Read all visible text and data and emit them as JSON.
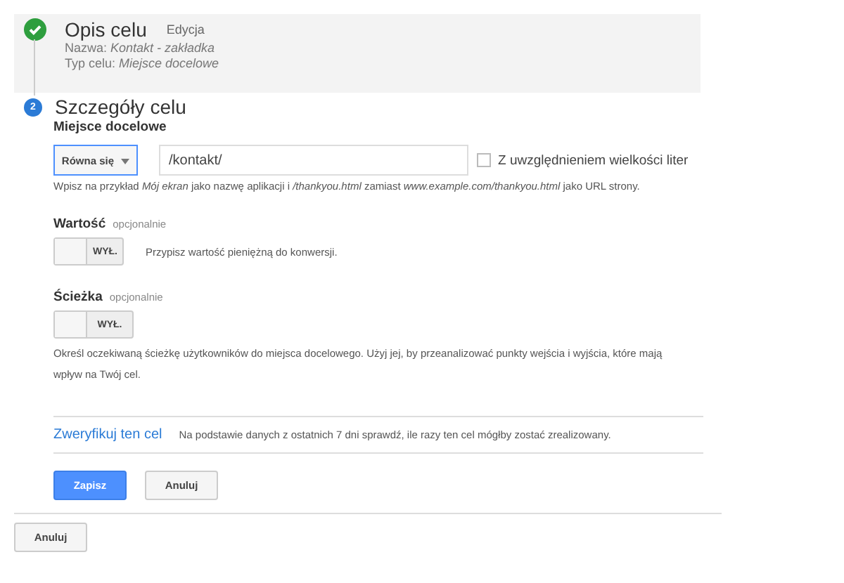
{
  "step1": {
    "title": "Opis celu",
    "edit_link": "Edycja",
    "lines": [
      "Nazwa: *Kontakt - zakładka*",
      "Typ celu: *Miejsce docelowe*"
    ]
  },
  "step2": {
    "number": "2",
    "title": "Szczegóły celu"
  },
  "destination": {
    "label": "Miejsce docelowe",
    "match": "Równa się",
    "value": "/kontakt/",
    "case_checkbox": {
      "label": "Z uwzględnieniem wielkości liter",
      "checked": false
    },
    "hint": "Wpisz na przykład *Mój ekran* jako nazwę aplikacji i */thankyou.html* zamiast *www.example.com/thankyou.html* jako URL strony."
  },
  "value_section": {
    "label": "Wartość",
    "optional": "opcjonalnie",
    "toggle": {
      "on": false,
      "text": "WYŁ."
    },
    "hint": "Przypisz wartość pieniężną do konwersji."
  },
  "path_section": {
    "label": "Ścieżka",
    "optional": "opcjonalnie",
    "toggle": {
      "on": false,
      "text": "WYŁ."
    },
    "hint": "Określ oczekiwaną ścieżkę użytkowników do miejsca docelowego. Użyj jej, by przeanalizować punkty wejścia i wyjścia, które mają wpływ na Twój cel."
  },
  "verify": {
    "link": "Zweryfikuj ten cel",
    "text": "Na podstawie danych z ostatnich 7 dni sprawdź, ile razy ten cel mógłby zostać zrealizowany."
  },
  "buttons": [
    "Zapisz",
    "Anuluj"
  ],
  "bottom_button": "Anuluj"
}
